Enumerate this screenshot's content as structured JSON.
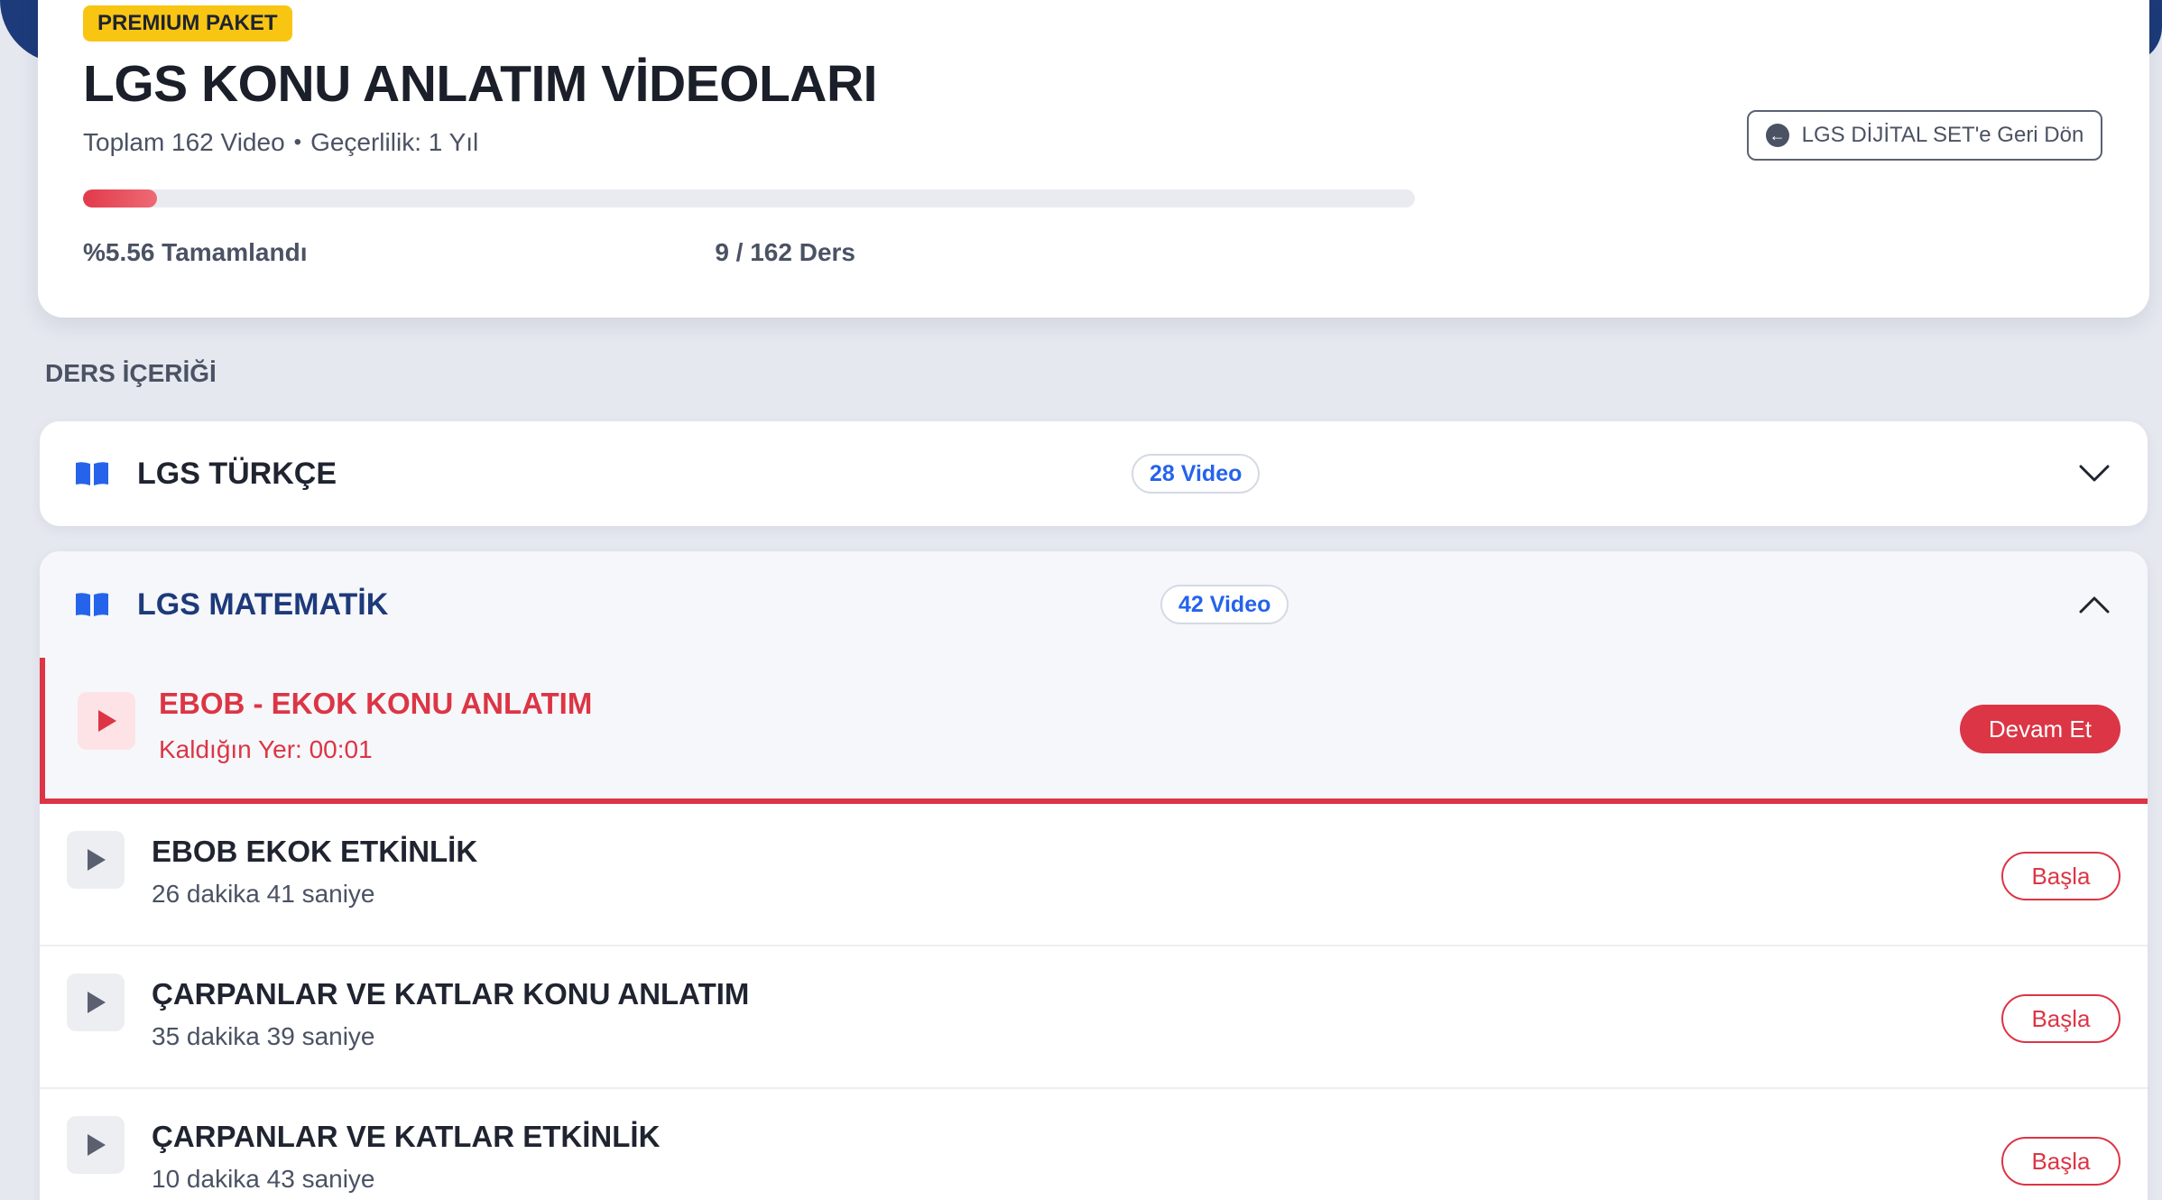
{
  "header": {
    "badge": "PREMIUM PAKET",
    "title": "LGS KONU ANLATIM VİDEOLARI",
    "total_videos": "Toplam 162 Video",
    "separator": "•",
    "validity": "Geçerlilik: 1 Yıl",
    "progress_percent": 5.56,
    "progress_label": "%5.56 Tamamlandı",
    "progress_count": "9 / 162 Ders",
    "back_button": "LGS DİJİTAL SET'e Geri Dön",
    "back_icon": "arrow-left-circle-icon"
  },
  "section_label": "DERS İÇERİĞİ",
  "courses": [
    {
      "title": "LGS TÜRKÇE",
      "video_count": "28 Video",
      "expanded": false,
      "icon": "open-book-icon"
    },
    {
      "title": "LGS MATEMATİK",
      "video_count": "42 Video",
      "expanded": true,
      "icon": "open-book-icon",
      "lessons": [
        {
          "title": "EBOB - EKOK KONU ANLATIM",
          "meta": "Kaldığın Yer: 00:01",
          "action": "Devam Et",
          "active": true
        },
        {
          "title": "EBOB EKOK ETKİNLİK",
          "meta": "26 dakika 41 saniye",
          "action": "Başla",
          "active": false
        },
        {
          "title": "ÇARPANLAR VE KATLAR KONU ANLATIM",
          "meta": "35 dakika 39 saniye",
          "action": "Başla",
          "active": false
        },
        {
          "title": "ÇARPANLAR VE KATLAR ETKİNLİK",
          "meta": "10 dakika 43 saniye",
          "action": "Başla",
          "active": false
        }
      ]
    }
  ],
  "colors": {
    "accent_red": "#dc3545",
    "badge_yellow": "#f9c513",
    "link_blue": "#2563eb",
    "navy": "#1d3a7a"
  }
}
